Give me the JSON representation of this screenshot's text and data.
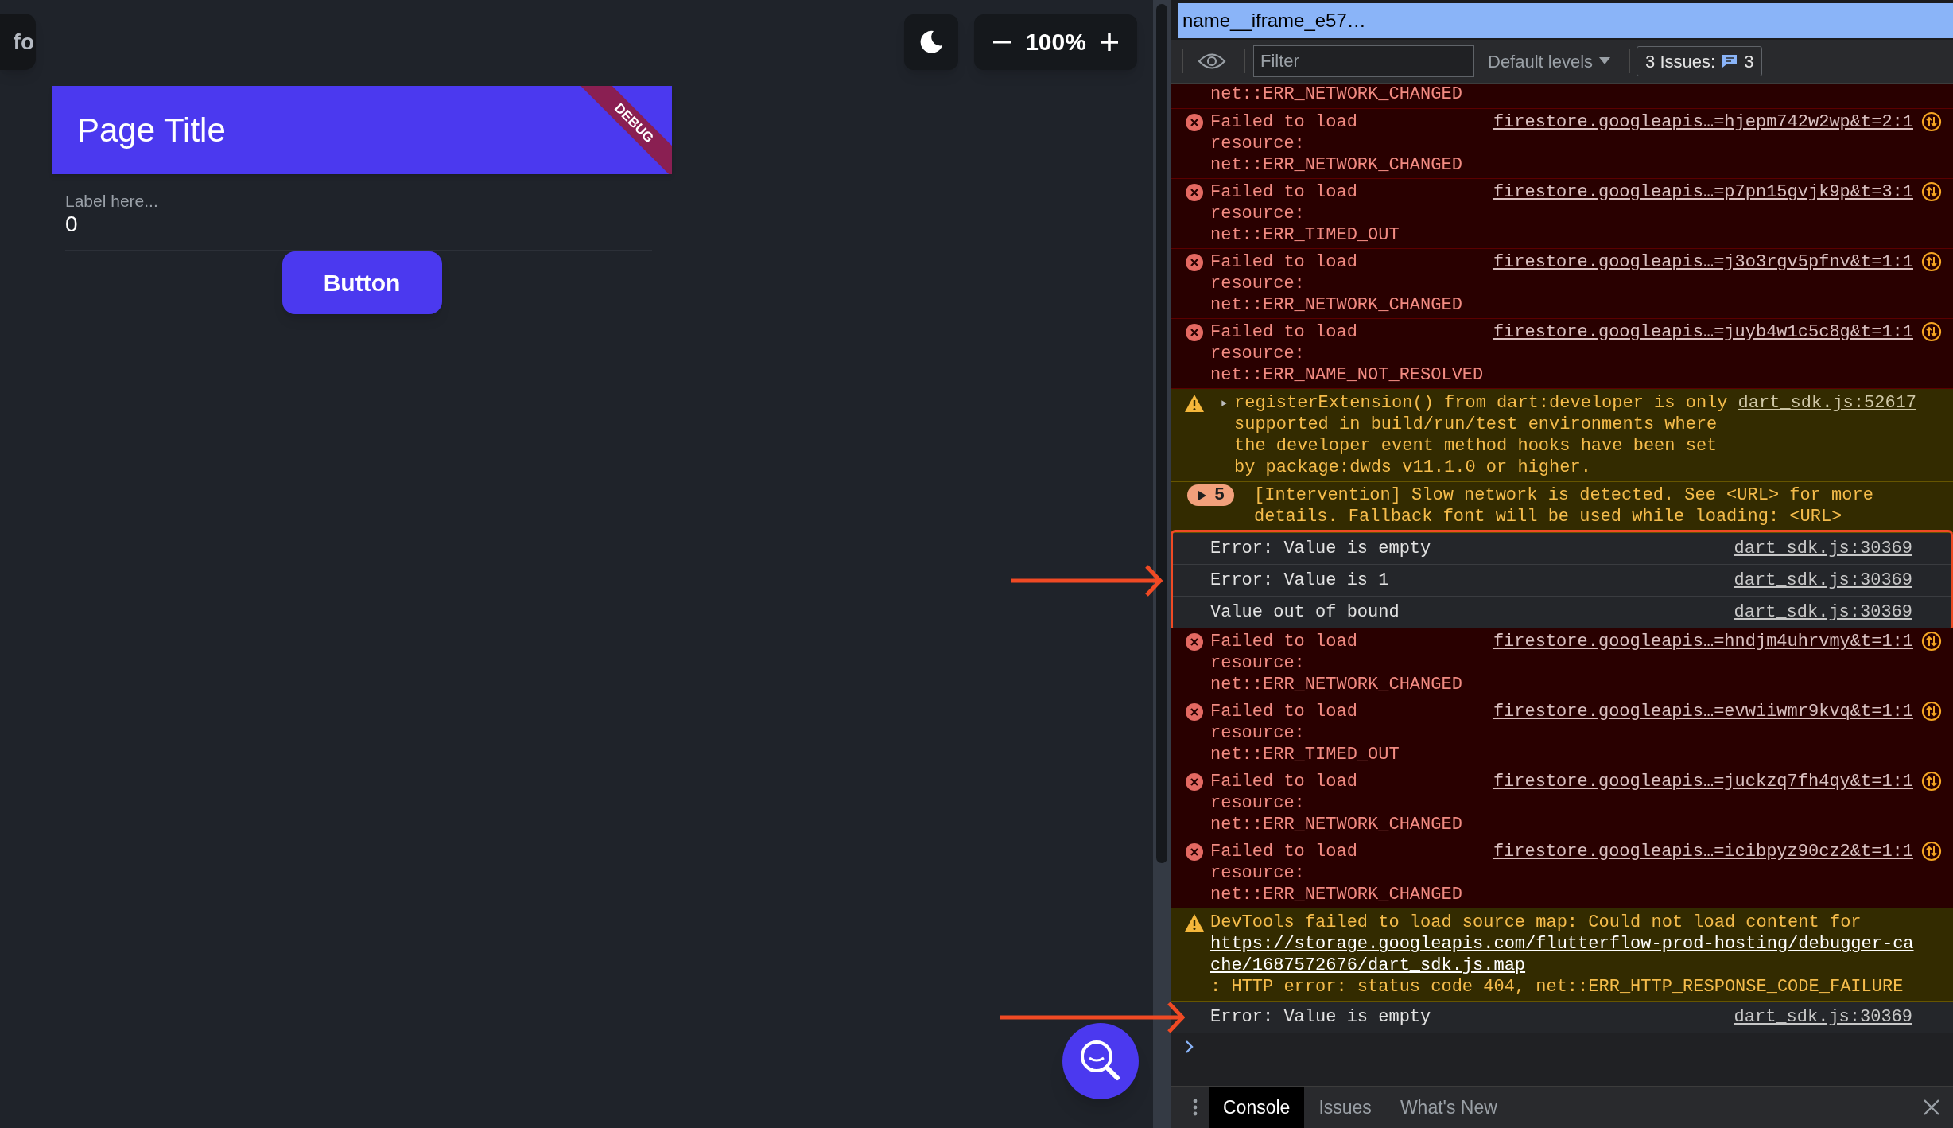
{
  "app": {
    "corner_chip": "fo",
    "zoom_level": "100%",
    "header": {
      "title": "Page Title",
      "banner": "DEBUG"
    },
    "field": {
      "label": "Label here...",
      "value": "0"
    },
    "button": "Button"
  },
  "devtools": {
    "frame_title": "name__iframe_e57…",
    "toolbar": {
      "filter_placeholder": "Filter",
      "levels": "Default levels",
      "issues_label": "3 Issues:",
      "issues_count": "3"
    },
    "console": [
      {
        "kind": "tail",
        "message": "net::ERR_NETWORK_CHANGED",
        "highlighted": false,
        "arrow": false
      },
      {
        "kind": "error",
        "message": "Failed to load\nresource:\nnet::ERR_NETWORK_CHANGED",
        "source": "firestore.googleapis…=hjepm742w2wp&t=2:1",
        "highlighted": false,
        "arrow": false
      },
      {
        "kind": "error",
        "message": "Failed to load\nresource:\nnet::ERR_TIMED_OUT",
        "source": "firestore.googleapis…=p7pn15gvjk9p&t=3:1",
        "highlighted": false,
        "arrow": false
      },
      {
        "kind": "error",
        "message": "Failed to load\nresource:\nnet::ERR_NETWORK_CHANGED",
        "source": "firestore.googleapis…=j3o3rgv5pfnv&t=1:1",
        "highlighted": false,
        "arrow": false
      },
      {
        "kind": "error",
        "message": "Failed to load\nresource:\nnet::ERR_NAME_NOT_RESOLVED",
        "source": "firestore.googleapis…=juyb4w1c5c8g&t=1:1",
        "highlighted": false,
        "arrow": false
      },
      {
        "kind": "warning",
        "expanded": false,
        "message": "registerExtension() from dart:developer is only supported in build/run/test environments where the developer event method hooks have been set by package:dwds v11.1.0 or higher.",
        "source": "dart_sdk.js:52617",
        "highlighted": false,
        "arrow": false
      },
      {
        "kind": "group",
        "expanded": false,
        "count": "5",
        "message": "[Intervention] Slow network is detected. See <URL> for more details. Fallback font will be used while loading: <URL>",
        "highlighted": false,
        "arrow": false
      },
      {
        "kind": "log",
        "message": "Error: Value is empty",
        "source": "dart_sdk.js:30369",
        "highlighted": true,
        "arrow": false
      },
      {
        "kind": "log",
        "message": "Error: Value is 1",
        "source": "dart_sdk.js:30369",
        "highlighted": true,
        "arrow": true
      },
      {
        "kind": "log",
        "message": "Value out of bound",
        "source": "dart_sdk.js:30369",
        "highlighted": true,
        "arrow": false
      },
      {
        "kind": "error",
        "message": "Failed to load\nresource:\nnet::ERR_NETWORK_CHANGED",
        "source": "firestore.googleapis…=hndjm4uhrvmy&t=1:1",
        "highlighted": false,
        "arrow": false
      },
      {
        "kind": "error",
        "message": "Failed to load\nresource:\nnet::ERR_TIMED_OUT",
        "source": "firestore.googleapis…=evwiiwmr9kvq&t=1:1",
        "highlighted": false,
        "arrow": false
      },
      {
        "kind": "error",
        "message": "Failed to load\nresource:\nnet::ERR_NETWORK_CHANGED",
        "source": "firestore.googleapis…=juckzq7fh4qy&t=1:1",
        "highlighted": false,
        "arrow": false
      },
      {
        "kind": "error",
        "message": "Failed to load\nresource:\nnet::ERR_NETWORK_CHANGED",
        "source": "firestore.googleapis…=icibpyz90cz2&t=1:1",
        "highlighted": false,
        "arrow": false
      },
      {
        "kind": "warning",
        "message": "DevTools failed to load source map: Could not load content for ",
        "link": "https://storage.googleapis.com/flutterflow-prod-hosting/debugger-cache/1687572676/dart_sdk.js.map",
        "message_after": ": HTTP error: status code 404, net::ERR_HTTP_RESPONSE_CODE_FAILURE",
        "highlighted": false,
        "arrow": false
      },
      {
        "kind": "log",
        "message": "Error: Value is empty",
        "source": "dart_sdk.js:30369",
        "highlighted": false,
        "arrow": true
      }
    ],
    "tabs": [
      {
        "label": "Console",
        "selected": true
      },
      {
        "label": "Issues",
        "selected": false
      },
      {
        "label": "What's New",
        "selected": false
      }
    ]
  }
}
